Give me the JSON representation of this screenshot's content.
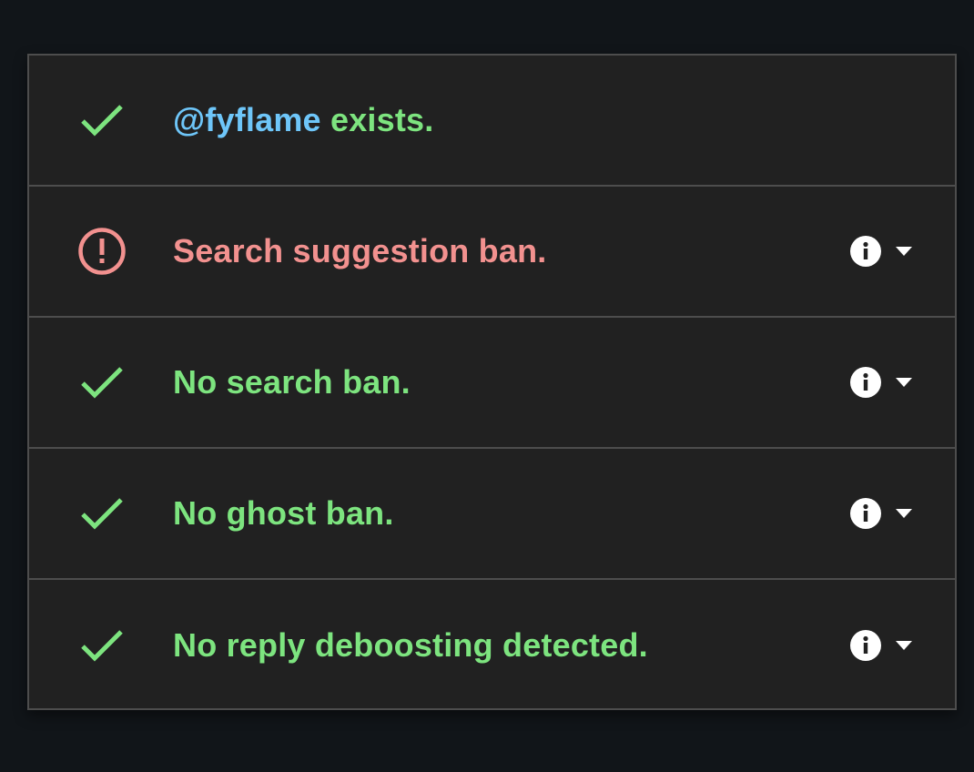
{
  "colors": {
    "background": "#111519",
    "panel": "#212121",
    "border": "#4d4d4d",
    "success": "#7de47f",
    "danger": "#f2918f",
    "handle": "#6ec6f9",
    "icon": "#ffffff"
  },
  "rows": [
    {
      "status": "ok",
      "icon": "check-icon",
      "handle": "@fyflame",
      "text": " exists.",
      "has_details": false
    },
    {
      "status": "warn",
      "icon": "alert-circle-icon",
      "text": "Search suggestion ban.",
      "has_details": true
    },
    {
      "status": "ok",
      "icon": "check-icon",
      "text": "No search ban.",
      "has_details": true
    },
    {
      "status": "ok",
      "icon": "check-icon",
      "text": "No ghost ban.",
      "has_details": true
    },
    {
      "status": "ok",
      "icon": "check-icon",
      "text": "No reply deboosting detected.",
      "has_details": true
    }
  ]
}
